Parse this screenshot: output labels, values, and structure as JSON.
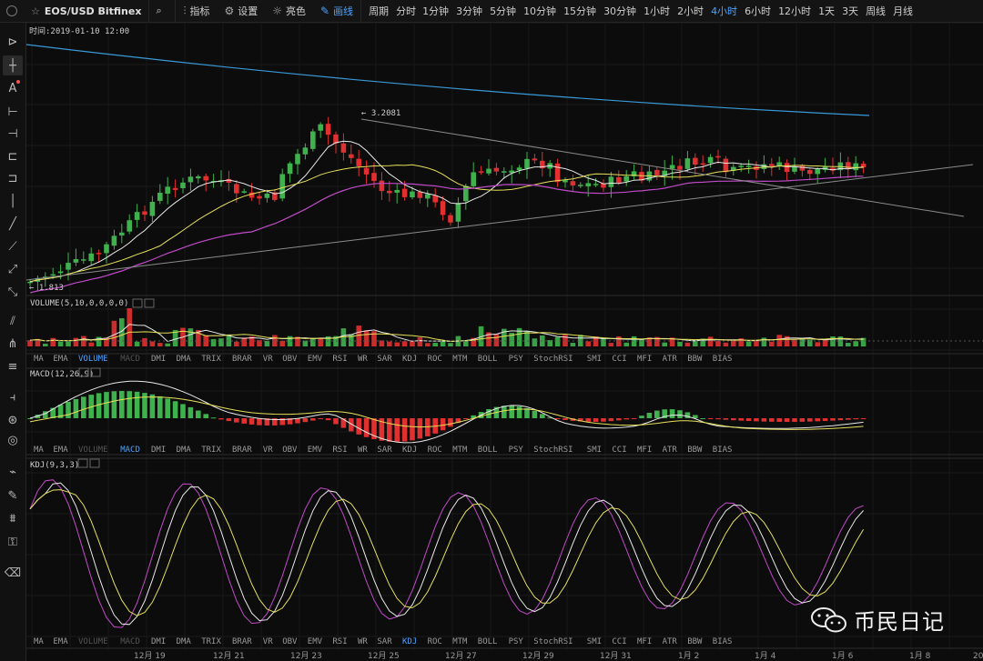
{
  "toolbar": {
    "symbol": "EOS/USD Bitfinex",
    "indicators_label": "指标",
    "settings_label": "设置",
    "theme_label": "亮色",
    "draw_label": "画线",
    "period_label": "周期",
    "periods": [
      "分时",
      "1分钟",
      "3分钟",
      "5分钟",
      "10分钟",
      "15分钟",
      "30分钟",
      "1小时",
      "2小时",
      "4小时",
      "6小时",
      "12小时",
      "1天",
      "3天",
      "周线",
      "月线"
    ],
    "active_period": "4小时"
  },
  "chart": {
    "time_label": "时间:2019-01-10 12:00",
    "high_label": "3.2081",
    "low_label": "1.813",
    "volume_title": "VOLUME(5,10,0,0,0,0)",
    "macd_title": "MACD(12,26,9)",
    "kdj_title": "KDJ(9,3,3)",
    "indicator_tabs": [
      "MA",
      "EMA",
      "VOLUME",
      "MACD",
      "DMI",
      "DMA",
      "TRIX",
      "BRAR",
      "VR",
      "OBV",
      "EMV",
      "RSI",
      "WR",
      "SAR",
      "KDJ",
      "ROC",
      "MTM",
      "BOLL",
      "PSY",
      "StochRSI",
      "SMI",
      "CCI",
      "MFI",
      "ATR",
      "BBW",
      "BIAS"
    ],
    "tabs_row1_active": "VOLUME",
    "tabs_row2_active": "MACD",
    "tabs_row3_active": "KDJ",
    "x_labels": [
      "12月 19",
      "12月 21",
      "12月 23",
      "12月 25",
      "12月 27",
      "12月 29",
      "12月 31",
      "1月 2",
      "1月 4",
      "1月 6",
      "1月 8",
      "20"
    ]
  },
  "colors": {
    "up": "#3fb24d",
    "down": "#e03030",
    "accent": "#4aa3ff"
  },
  "watermark": {
    "text": "币民日记"
  },
  "left_tools": [
    "cursor-icon",
    "crosshair-icon",
    "text-icon",
    "hline-icon",
    "hray-icon",
    "hsegment-icon",
    "channel-icon",
    "vline-icon",
    "trendline-icon",
    "ray-icon",
    "extended-line-icon",
    "arrow-line-icon",
    "parallel-channel-icon",
    "pitchfork-icon",
    "fib-icon",
    "fib-fan-icon",
    "gann-icon",
    "spiral-icon",
    "ruler-icon",
    "brush-icon",
    "pattern-icon",
    "lock-icon",
    "trash-icon"
  ]
}
